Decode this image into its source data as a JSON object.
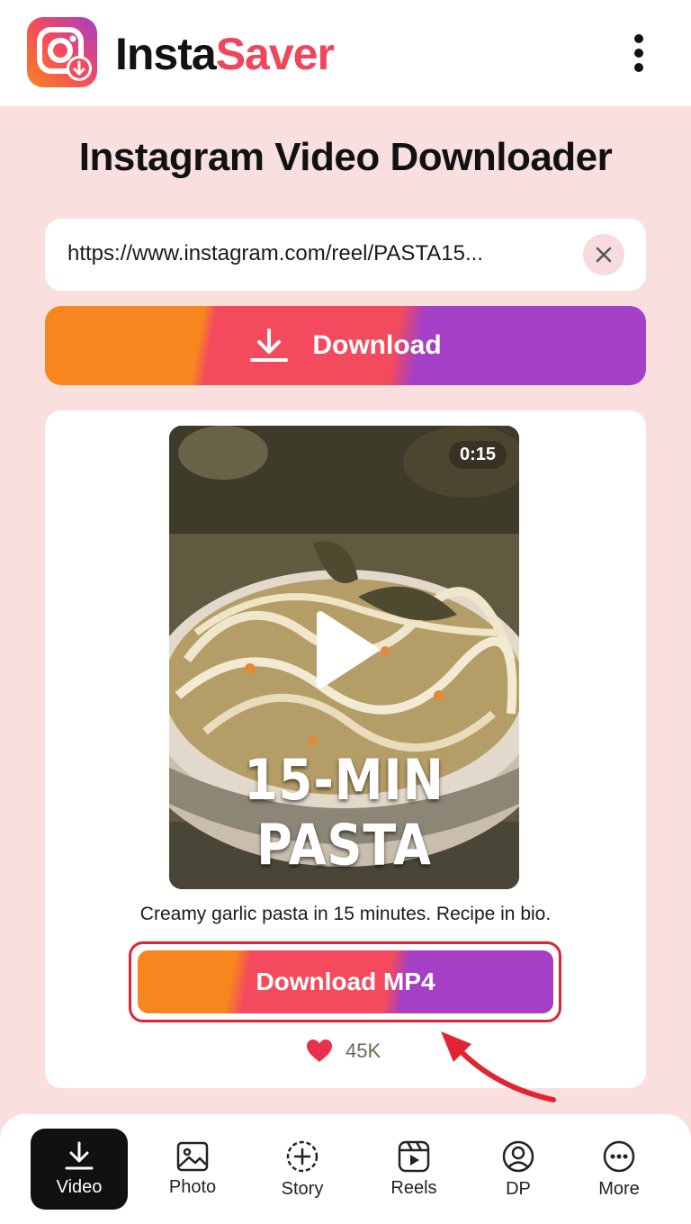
{
  "app": {
    "brand_part1": "Insta",
    "brand_part2": "Saver"
  },
  "header": {
    "title": "Instagram Video Downloader"
  },
  "search": {
    "url_value": "https://www.instagram.com/reel/PASTA15..."
  },
  "download_button": {
    "label": "Download"
  },
  "result": {
    "duration": "0:15",
    "thumbnail_title": "15-MIN PASTA",
    "caption": "Creamy garlic pasta in 15 minutes. Recipe in bio.",
    "download_mp4_label": "Download MP4",
    "likes": "45K"
  },
  "bottom_nav": {
    "items": [
      {
        "label": "Video",
        "icon": "download-icon",
        "active": true
      },
      {
        "label": "Photo",
        "icon": "image-icon"
      },
      {
        "label": "Story",
        "icon": "plus-circle-icon"
      },
      {
        "label": "Reels",
        "icon": "reels-icon"
      },
      {
        "label": "DP",
        "icon": "user-icon"
      },
      {
        "label": "More",
        "icon": "more-icon"
      }
    ]
  },
  "colors": {
    "orange": "#f7861f",
    "pink": "#f44a5e",
    "purple": "#a43fc6",
    "highlight": "#e02432"
  }
}
